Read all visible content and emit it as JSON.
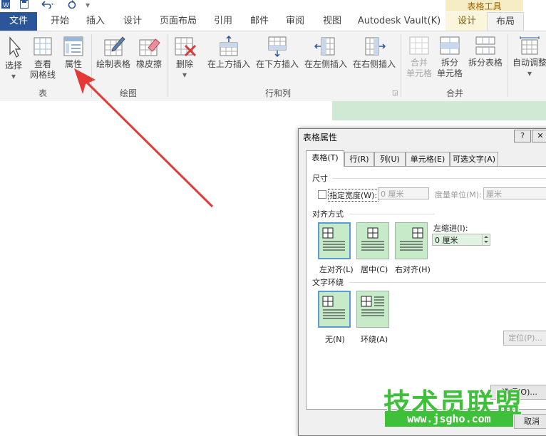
{
  "quick_access": {
    "word_icon": "word-app-icon",
    "save_icon": "save-icon",
    "undo_icon": "undo-icon",
    "redo_icon": "redo-icon"
  },
  "context_group_title": "表格工具",
  "tabs": [
    {
      "label": "文件"
    },
    {
      "label": "开始"
    },
    {
      "label": "插入"
    },
    {
      "label": "设计"
    },
    {
      "label": "页面布局"
    },
    {
      "label": "引用"
    },
    {
      "label": "邮件"
    },
    {
      "label": "审阅"
    },
    {
      "label": "视图"
    },
    {
      "label": "Autodesk Vault(K)"
    },
    {
      "label": "设计"
    },
    {
      "label": "布局"
    }
  ],
  "ribbon": {
    "select": "选择",
    "view_gridlines_1": "查看",
    "view_gridlines_2": "网格线",
    "properties": "属性",
    "draw_table": "绘制表格",
    "eraser": "橡皮擦",
    "delete": "删除",
    "insert_above": "在上方插入",
    "insert_below": "在下方插入",
    "insert_left": "在左侧插入",
    "insert_right": "在右侧插入",
    "merge_cells_1": "合并",
    "merge_cells_2": "单元格",
    "split_cells_1": "拆分",
    "split_cells_2": "单元格",
    "split_table": "拆分表格",
    "autofit": "自动调整",
    "groups": {
      "table": "表",
      "draw": "绘图",
      "rows_cols": "行和列",
      "merge": "合并"
    }
  },
  "dialog": {
    "title": "表格属性",
    "help_button": "?",
    "tabs": [
      "表格(T)",
      "行(R)",
      "列(U)",
      "单元格(E)",
      "可选文字(A)"
    ],
    "size_section": "尺寸",
    "preferred_width_label": "指定宽度(W):",
    "preferred_width_value": "0 厘米",
    "measure_in_label": "度量单位(M):",
    "measure_in_value": "厘米",
    "alignment_section": "对齐方式",
    "indent_label": "左缩进(I):",
    "indent_value": "0 厘米",
    "align_left": "左对齐(L)",
    "align_center": "居中(C)",
    "align_right": "右对齐(H)",
    "wrap_section": "文字环绕",
    "wrap_none": "无(N)",
    "wrap_around": "环绕(A)",
    "position_button": "定位(P)...",
    "options_button": "选项(O)...",
    "cancel_button": "取消"
  },
  "watermark": {
    "line1": "技术员联盟",
    "line2": "www.jsgho.com"
  },
  "colors": {
    "file_tab": "#2b579a",
    "context_tab": "#f6edc7",
    "arrow": "#e53935",
    "selected_align_border": "#5b9bd5",
    "watermark": "#3fc03a"
  }
}
